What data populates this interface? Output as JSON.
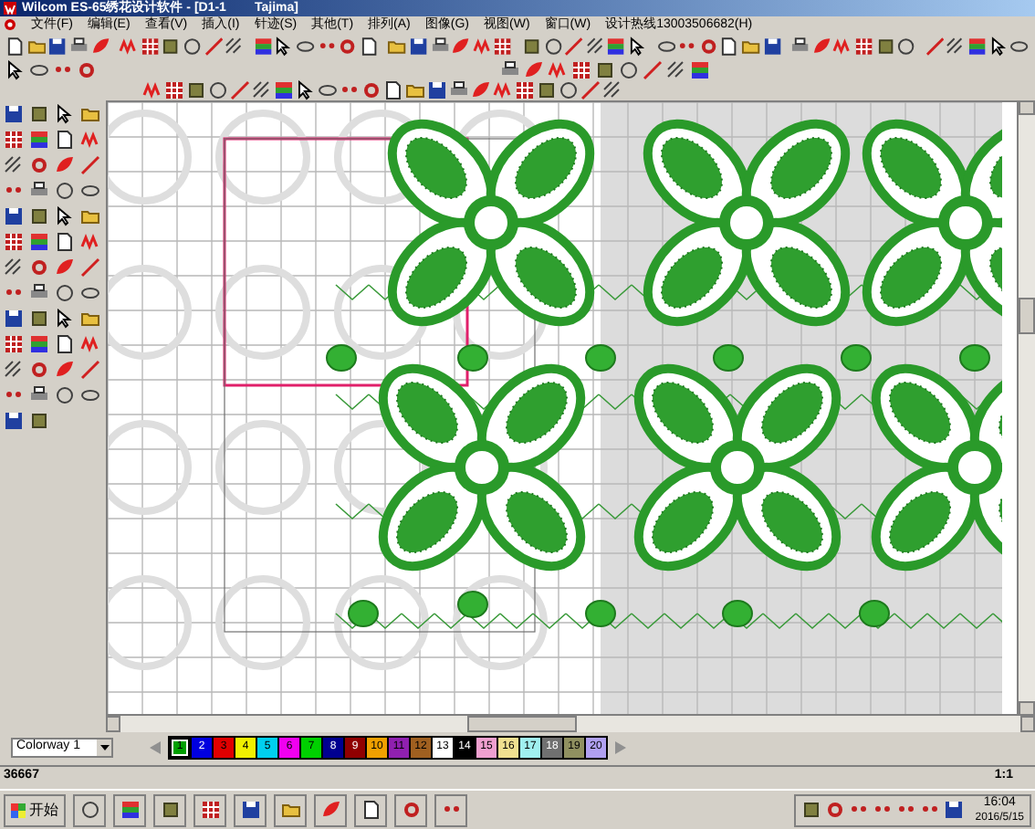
{
  "window": {
    "title": "Wilcom ES-65绣花设计软件 - [D1-1        Tajima]"
  },
  "menu": [
    {
      "label": "文件(F)"
    },
    {
      "label": "编辑(E)"
    },
    {
      "label": "查看(V)"
    },
    {
      "label": "插入(I)"
    },
    {
      "label": "针迹(S)"
    },
    {
      "label": "其他(T)"
    },
    {
      "label": "排列(A)"
    },
    {
      "label": "图像(G)"
    },
    {
      "label": "视图(W)"
    },
    {
      "label": "窗口(W)"
    },
    {
      "label": "设计热线13003506682(H)"
    }
  ],
  "colorway": {
    "value": "Colorway 1"
  },
  "palette": [
    {
      "label": "1",
      "color": "#00a000",
      "selected": true
    },
    {
      "label": "2",
      "color": "#0000e0",
      "selected": false
    },
    {
      "label": "3",
      "color": "#e00000",
      "selected": false
    },
    {
      "label": "4",
      "color": "#f0f000",
      "selected": false
    },
    {
      "label": "5",
      "color": "#00d0f0",
      "selected": false
    },
    {
      "label": "6",
      "color": "#f000f0",
      "selected": false
    },
    {
      "label": "7",
      "color": "#00d000",
      "selected": false
    },
    {
      "label": "8",
      "color": "#000090",
      "selected": false
    },
    {
      "label": "9",
      "color": "#900000",
      "selected": false
    },
    {
      "label": "10",
      "color": "#f0a000",
      "selected": false
    },
    {
      "label": "11",
      "color": "#9020b0",
      "selected": false
    },
    {
      "label": "12",
      "color": "#a06020",
      "selected": false
    },
    {
      "label": "13",
      "color": "#ffffff",
      "selected": false
    },
    {
      "label": "14",
      "color": "#000000",
      "selected": false
    },
    {
      "label": "15",
      "color": "#f0a0d0",
      "selected": false
    },
    {
      "label": "16",
      "color": "#f0e090",
      "selected": false
    },
    {
      "label": "17",
      "color": "#a0f0f0",
      "selected": false
    },
    {
      "label": "18",
      "color": "#707070",
      "selected": false
    },
    {
      "label": "19",
      "color": "#909060",
      "selected": false
    },
    {
      "label": "20",
      "color": "#b0a0f0",
      "selected": false
    }
  ],
  "status_bar": {
    "stitches": "36667",
    "zoom": "1:1"
  },
  "taskbar": {
    "start": "开始",
    "time": "16:04",
    "date": "2016/5/15"
  }
}
